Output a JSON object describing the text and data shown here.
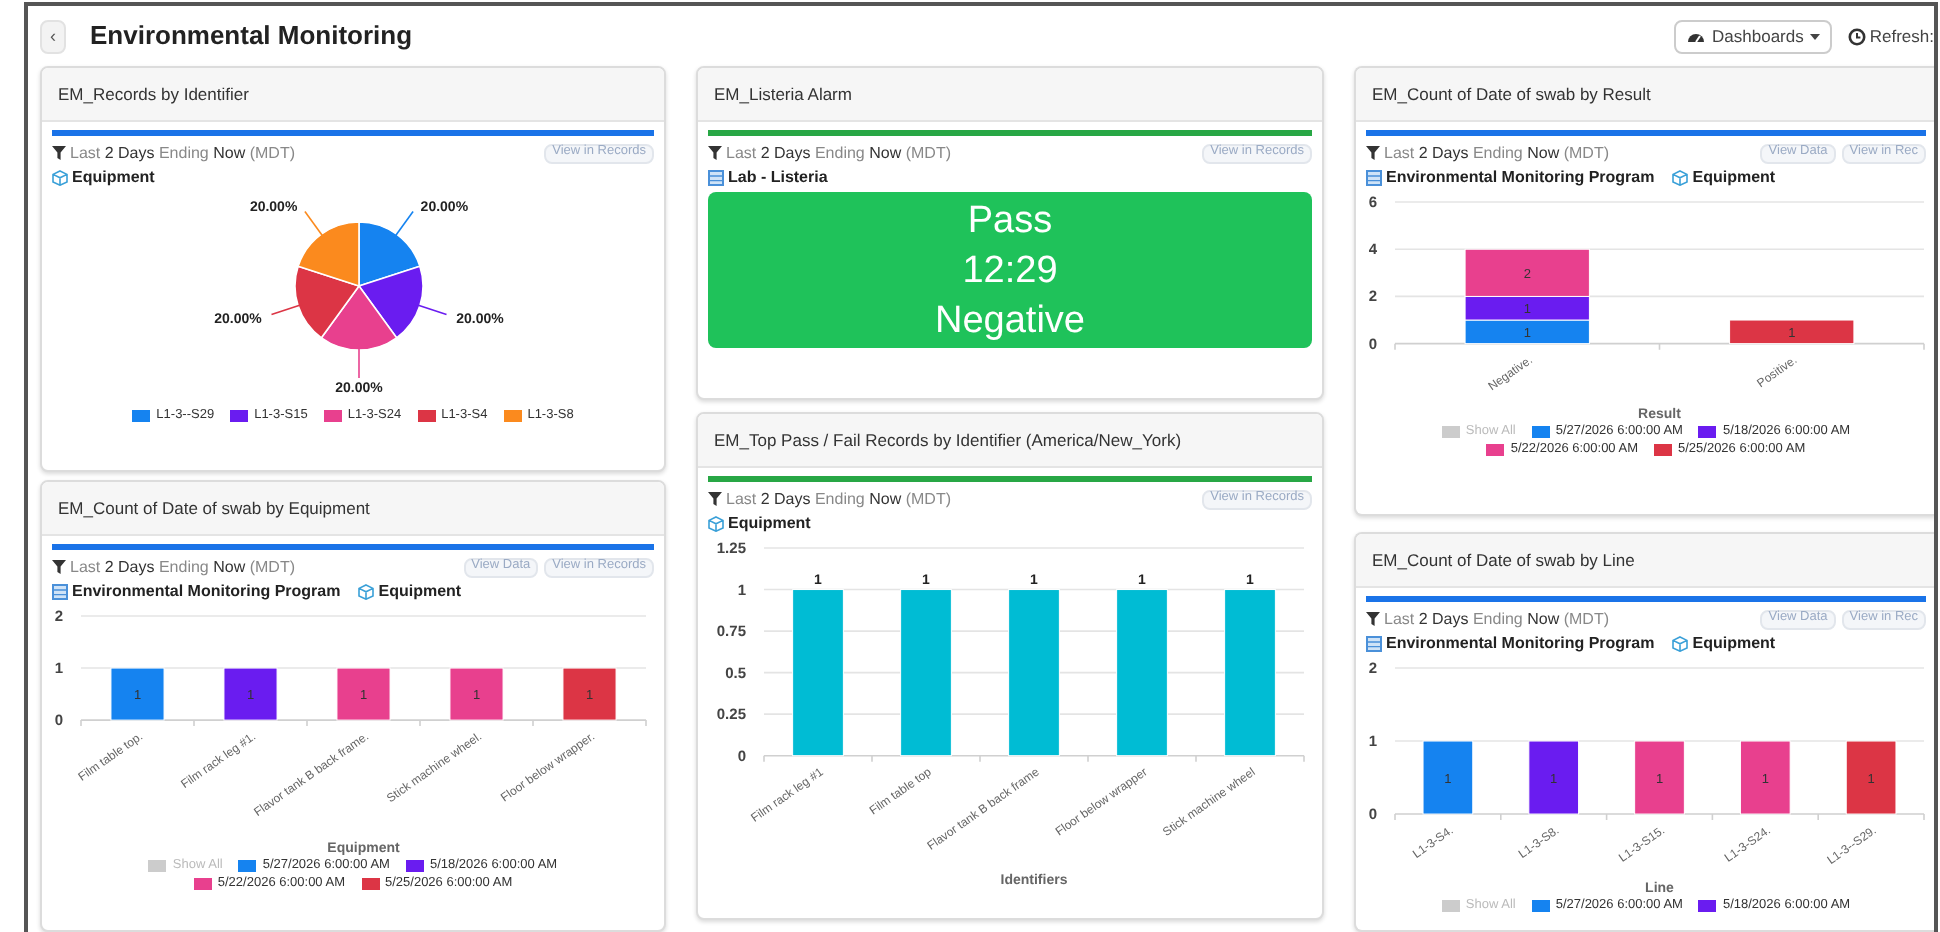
{
  "header": {
    "back": "‹",
    "title": "Environmental Monitoring",
    "dashboards_button": "Dashboards",
    "refresh": "Refresh:"
  },
  "columns": [
    {
      "cards": [
        {
          "kind": "pie",
          "title": "EM_Records by Identifier",
          "color": "#1a73e8",
          "filter": "Last **2 Days** Ending **Now** (MDT)",
          "buttons": [
            "View in Records"
          ],
          "sources": [
            {
              "kind": "cube",
              "label": "Equipment"
            }
          ],
          "chart_data": {
            "type": "pie",
            "categories": [
              "L1-3--S29",
              "L1-3-S15",
              "L1-3-S24",
              "L1-3-S4",
              "L1-3-S8"
            ],
            "values": [
              20,
              20,
              20,
              20,
              20
            ],
            "value_labels": [
              "20.00%",
              "20.00%",
              "20.00%",
              "20.00%",
              "20.00%"
            ],
            "colors": [
              "#1583f0",
              "#6a1cf0",
              "#e8408e",
              "#dc3545",
              "#fb8a1e"
            ]
          }
        },
        {
          "kind": "bar",
          "title": "EM_Count of Date of swab by Equipment",
          "color": "#1a73e8",
          "filter": "Last **2 Days** Ending **Now** (MDT)",
          "buttons": [
            "View Data",
            "View in Records"
          ],
          "sources": [
            {
              "kind": "table",
              "label": "Environmental Monitoring Program"
            },
            {
              "kind": "cube",
              "label": "Equipment"
            }
          ],
          "legend_toggle": "Show All",
          "chart_data": {
            "type": "bar",
            "stacked": true,
            "xlabel": "Equipment",
            "categories": [
              "Film table top.",
              "Film rack leg #1.",
              "Flavor tank B back frame.",
              "Stick machine wheel.",
              "Floor below wrapper."
            ],
            "ylim": [
              0,
              2
            ],
            "yticks": [
              0,
              1,
              2
            ],
            "grid": true,
            "data_labels": true,
            "series": [
              {
                "name": "5/27/2026 6:00:00 AM",
                "color": "#1583f0",
                "values": [
                  1,
                  null,
                  null,
                  null,
                  null
                ]
              },
              {
                "name": "5/18/2026 6:00:00 AM",
                "color": "#6a1cf0",
                "values": [
                  null,
                  1,
                  null,
                  null,
                  null
                ]
              },
              {
                "name": "5/22/2026 6:00:00 AM",
                "color": "#e8408e",
                "values": [
                  null,
                  null,
                  1,
                  1,
                  null
                ]
              },
              {
                "name": "5/25/2026 6:00:00 AM",
                "color": "#dc3545",
                "values": [
                  null,
                  null,
                  null,
                  null,
                  1
                ]
              }
            ]
          }
        }
      ]
    },
    {
      "cards": [
        {
          "kind": "alarm",
          "title": "EM_Listeria Alarm",
          "color": "#28a745",
          "filter": "Last **2 Days** Ending **Now** (MDT)",
          "buttons": [
            "View in Records"
          ],
          "sources": [
            {
              "kind": "table",
              "label": "Lab - Listeria"
            }
          ],
          "tile": {
            "color": "#1fc25a",
            "lines": [
              "Pass",
              "12:29",
              "Negative"
            ]
          }
        },
        {
          "kind": "bar",
          "title": "EM_Top Pass / Fail Records by Identifier (America/New_York)",
          "color": "#28a745",
          "filter": "Last **2 Days** Ending **Now** (MDT)",
          "buttons": [
            "View in Records"
          ],
          "sources": [
            {
              "kind": "cube",
              "label": "Equipment"
            }
          ],
          "chart_data": {
            "type": "bar",
            "stacked": false,
            "xlabel": "Identifiers",
            "categories": [
              "Film rack leg #1",
              "Film table top",
              "Flavor tank B back frame",
              "Floor below wrapper",
              "Stick machine wheel"
            ],
            "ylim": [
              0,
              1.25
            ],
            "yticks": [
              0,
              0.25,
              0.5,
              0.75,
              1,
              1.25
            ],
            "grid": true,
            "data_labels": true,
            "series": [
              {
                "color": "#00bcd4",
                "values": [
                  1,
                  1,
                  1,
                  1,
                  1
                ]
              }
            ]
          }
        }
      ]
    },
    {
      "cards": [
        {
          "kind": "bar",
          "title": "EM_Count of Date of swab by Result",
          "color": "#1a73e8",
          "filter": "Last **2 Days** Ending **Now** (MDT)",
          "buttons": [
            "View Data",
            "View in Rec"
          ],
          "sources": [
            {
              "kind": "table",
              "label": "Environmental Monitoring Program"
            },
            {
              "kind": "cube",
              "label": "Equipment"
            }
          ],
          "legend_toggle": "Show All",
          "chart_data": {
            "type": "bar",
            "stacked": true,
            "xlabel": "Result",
            "categories": [
              "Negative.",
              "Positive."
            ],
            "ylim": [
              0,
              6
            ],
            "yticks": [
              0,
              2,
              4,
              6
            ],
            "grid": true,
            "data_labels": true,
            "series": [
              {
                "name": "5/27/2026 6:00:00 AM",
                "color": "#1583f0",
                "values": [
                  1,
                  null
                ]
              },
              {
                "name": "5/18/2026 6:00:00 AM",
                "color": "#6a1cf0",
                "values": [
                  1,
                  null
                ]
              },
              {
                "name": "5/22/2026 6:00:00 AM",
                "color": "#e8408e",
                "values": [
                  2,
                  null
                ]
              },
              {
                "name": "5/25/2026 6:00:00 AM",
                "color": "#dc3545",
                "values": [
                  null,
                  1
                ]
              }
            ]
          }
        },
        {
          "kind": "bar",
          "title": "EM_Count of Date of swab by Line",
          "color": "#1a73e8",
          "filter": "Last **2 Days** Ending **Now** (MDT)",
          "buttons": [
            "View Data",
            "View in Rec"
          ],
          "sources": [
            {
              "kind": "table",
              "label": "Environmental Monitoring Program"
            },
            {
              "kind": "cube",
              "label": "Equipment"
            }
          ],
          "legend_toggle": "Show All",
          "chart_data": {
            "type": "bar",
            "stacked": true,
            "xlabel": "Line",
            "categories": [
              "L1-3-S4.",
              "L1-3-S8.",
              "L1-3-S15.",
              "L1-3-S24.",
              "L1-3--S29."
            ],
            "ylim": [
              0,
              2
            ],
            "yticks": [
              0,
              1,
              2
            ],
            "grid": true,
            "data_labels": true,
            "series": [
              {
                "name": "5/27/2026 6:00:00 AM",
                "color": "#1583f0",
                "values": [
                  1,
                  null,
                  null,
                  null,
                  null
                ]
              },
              {
                "name": "5/18/2026 6:00:00 AM",
                "color": "#6a1cf0",
                "values": [
                  null,
                  1,
                  null,
                  null,
                  null
                ]
              },
              {
                "color": "#e8408e",
                "values": [
                  null,
                  null,
                  1,
                  1,
                  null
                ]
              },
              {
                "color": "#dc3545",
                "values": [
                  null,
                  null,
                  null,
                  null,
                  1
                ]
              }
            ]
          }
        }
      ]
    }
  ]
}
